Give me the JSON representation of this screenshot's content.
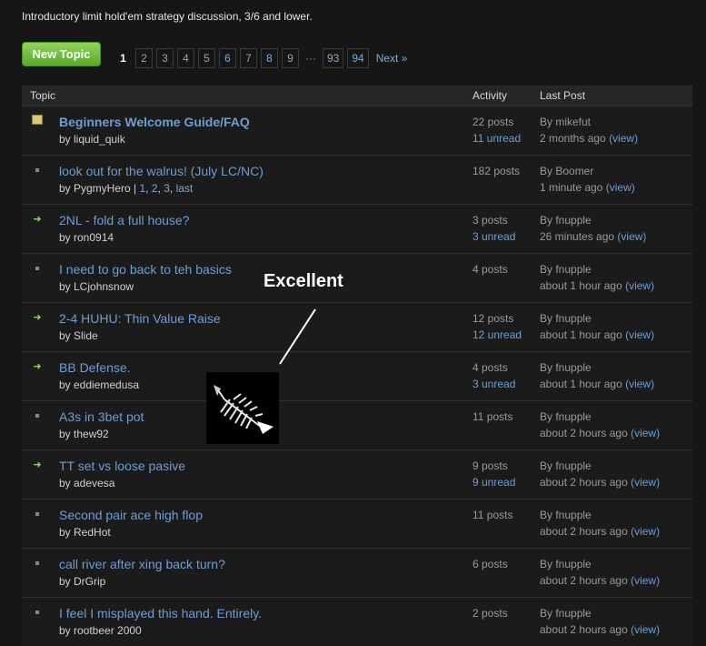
{
  "description": "Introductory limit hold'em strategy discussion, 3/6 and lower.",
  "new_topic_label": "New Topic",
  "pagination": {
    "current": "1",
    "pages": [
      "2",
      "3",
      "4",
      "5",
      "6",
      "7",
      "8",
      "9"
    ],
    "ellipsis": "···",
    "last_pages": [
      "93",
      "94"
    ],
    "next_label": "Next »"
  },
  "table_headers": {
    "topic": "Topic",
    "activity": "Activity",
    "last_post": "Last Post"
  },
  "topics": [
    {
      "icon": "sticky-note-icon",
      "title": "Beginners Welcome Guide/FAQ",
      "by": "by liquid_quik",
      "posts": "22 posts",
      "unread": "11 unread",
      "lp_by": "By mikefut",
      "lp_time": "2 months ago"
    },
    {
      "icon": "dot-icon",
      "title": "look out for the walrus! (July LC/NC)",
      "by": "by PygmyHero | ",
      "pagelinks": [
        "1",
        "2",
        "3",
        "last"
      ],
      "posts": "182 posts",
      "unread": "",
      "lp_by": "By Boomer",
      "lp_time": "1 minute ago"
    },
    {
      "icon": "arrow-icon",
      "title": "2NL - fold a full house?",
      "by": "by ron0914",
      "posts": "3 posts",
      "unread": "3 unread",
      "lp_by": "By fnupple",
      "lp_time": "26 minutes ago"
    },
    {
      "icon": "dot-icon",
      "title": "I need to go back to teh basics",
      "by": "by LCjohnsnow",
      "posts": "4 posts",
      "unread": "",
      "lp_by": "By fnupple",
      "lp_time": "about 1 hour ago"
    },
    {
      "icon": "arrow-icon",
      "title": "2-4 HUHU: Thin Value Raise",
      "by": "by Slide",
      "posts": "12 posts",
      "unread": "12 unread",
      "lp_by": "By fnupple",
      "lp_time": "about 1 hour ago"
    },
    {
      "icon": "arrow-icon",
      "title": "BB Defense.",
      "by": "by eddiemedusa",
      "posts": "4 posts",
      "unread": "3 unread",
      "lp_by": "By fnupple",
      "lp_time": "about 1 hour ago"
    },
    {
      "icon": "dot-icon",
      "title": "A3s in 3bet pot",
      "by": "by thew92",
      "posts": "11 posts",
      "unread": "",
      "lp_by": "By fnupple",
      "lp_time": "about 2 hours ago"
    },
    {
      "icon": "arrow-icon",
      "title": "TT set vs loose pasive",
      "by": "by adevesa",
      "posts": "9 posts",
      "unread": "9 unread",
      "lp_by": "By fnupple",
      "lp_time": "about 2 hours ago"
    },
    {
      "icon": "dot-icon",
      "title": "Second pair ace high flop",
      "by": "by RedHot",
      "posts": "11 posts",
      "unread": "",
      "lp_by": "By fnupple",
      "lp_time": "about 2 hours ago"
    },
    {
      "icon": "dot-icon",
      "title": "call river after xing back turn?",
      "by": "by DrGrip",
      "posts": "6 posts",
      "unread": "",
      "lp_by": "By fnupple",
      "lp_time": "about 2 hours ago"
    },
    {
      "icon": "dot-icon",
      "title": "I feel I misplayed this hand. Entirely.",
      "by": "by rootbeer 2000",
      "posts": "2 posts",
      "unread": "",
      "lp_by": "By fnupple",
      "lp_time": "about 2 hours ago"
    }
  ],
  "view_label": "(view)",
  "overlay_caption": "Excellent",
  "colors": {
    "link": "#6f9dd1",
    "button": "#6fbf3a",
    "background": "#161616"
  }
}
